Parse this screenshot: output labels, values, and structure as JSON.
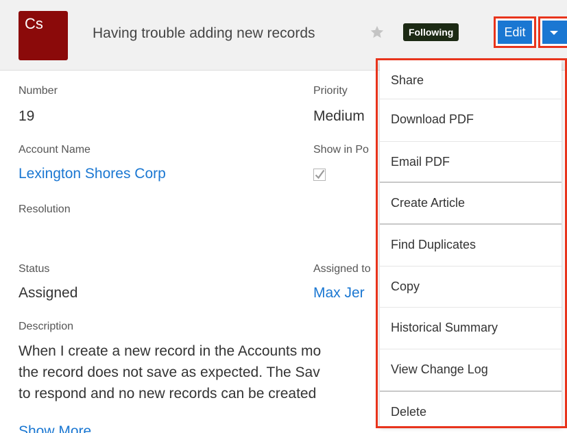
{
  "header": {
    "avatar_text": "Cs",
    "title": "Having trouble adding new records",
    "following_label": "Following",
    "edit_label": "Edit",
    "star_icon": "star-icon",
    "caret_icon": "caret-down-icon"
  },
  "fields": {
    "number_label": "Number",
    "number_value": "19",
    "priority_label": "Priority",
    "priority_value": "Medium",
    "account_label": "Account Name",
    "account_value": "Lexington Shores Corp",
    "portal_label": "Show in Po",
    "portal_checked": true,
    "resolution_label": "Resolution",
    "status_label": "Status",
    "status_value": "Assigned",
    "assigned_label": "Assigned to",
    "assigned_value": "Max Jer",
    "description_label": "Description",
    "description_lines": [
      "When I create a new record in the Accounts mo",
      "the record does not save as expected. The Sav",
      "to respond and no new records can be created"
    ],
    "show_more": "Show More"
  },
  "menu": {
    "items": [
      {
        "label": "Share"
      },
      {
        "label": "Download PDF"
      },
      {
        "label": "Email PDF"
      },
      {
        "label": "Create Article"
      },
      {
        "label": "Find Duplicates"
      },
      {
        "label": "Copy"
      },
      {
        "label": "Historical Summary"
      },
      {
        "label": "View Change Log"
      },
      {
        "label": "Delete"
      }
    ]
  },
  "colors": {
    "accent_blue": "#1a77d2",
    "avatar_red": "#8b0a0a",
    "highlight_red": "#e8341c",
    "following_badge": "#1c2a14"
  }
}
